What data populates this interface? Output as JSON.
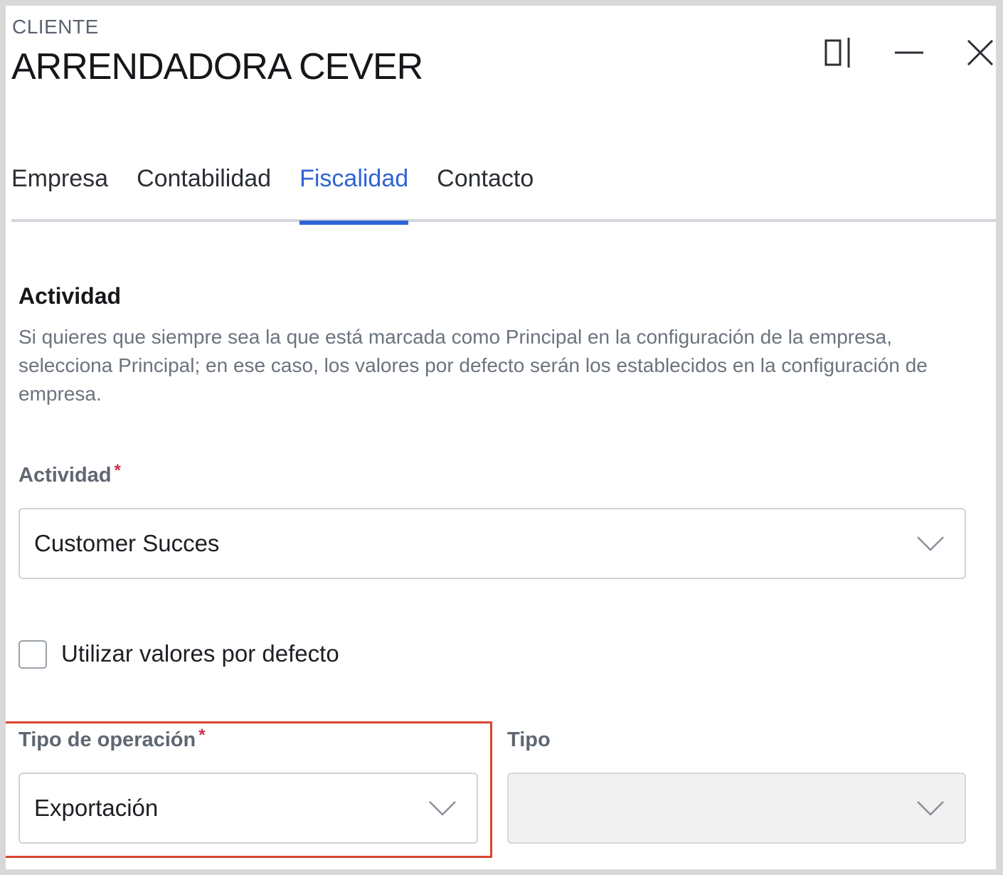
{
  "header": {
    "eyebrow": "CLIENTE",
    "title": "ARRENDADORA CEVER"
  },
  "window_controls": [
    {
      "name": "split-view-icon"
    },
    {
      "name": "minimize-icon"
    },
    {
      "name": "close-icon"
    }
  ],
  "tabs": [
    {
      "label": "Empresa",
      "active": false
    },
    {
      "label": "Contabilidad",
      "active": false
    },
    {
      "label": "Fiscalidad",
      "active": true
    },
    {
      "label": "Contacto",
      "active": false
    }
  ],
  "section": {
    "title": "Actividad",
    "description": "Si quieres que siempre sea la que está marcada como Principal en la configuración de la empresa, selecciona Principal; en ese caso, los valores por defecto serán los establecidos en la configuración de empresa."
  },
  "actividad_field": {
    "label": "Actividad",
    "required_mark": "*",
    "value": "Customer Succes"
  },
  "default_values_checkbox": {
    "label": "Utilizar valores por defecto",
    "checked": false
  },
  "tipo_operacion_field": {
    "label": "Tipo de operación",
    "required_mark": "*",
    "value": "Exportación"
  },
  "tipo_field": {
    "label": "Tipo",
    "value": "",
    "disabled": true
  },
  "colors": {
    "accent": "#2f64d6",
    "highlight": "#d9472f",
    "required": "#c8324b"
  }
}
